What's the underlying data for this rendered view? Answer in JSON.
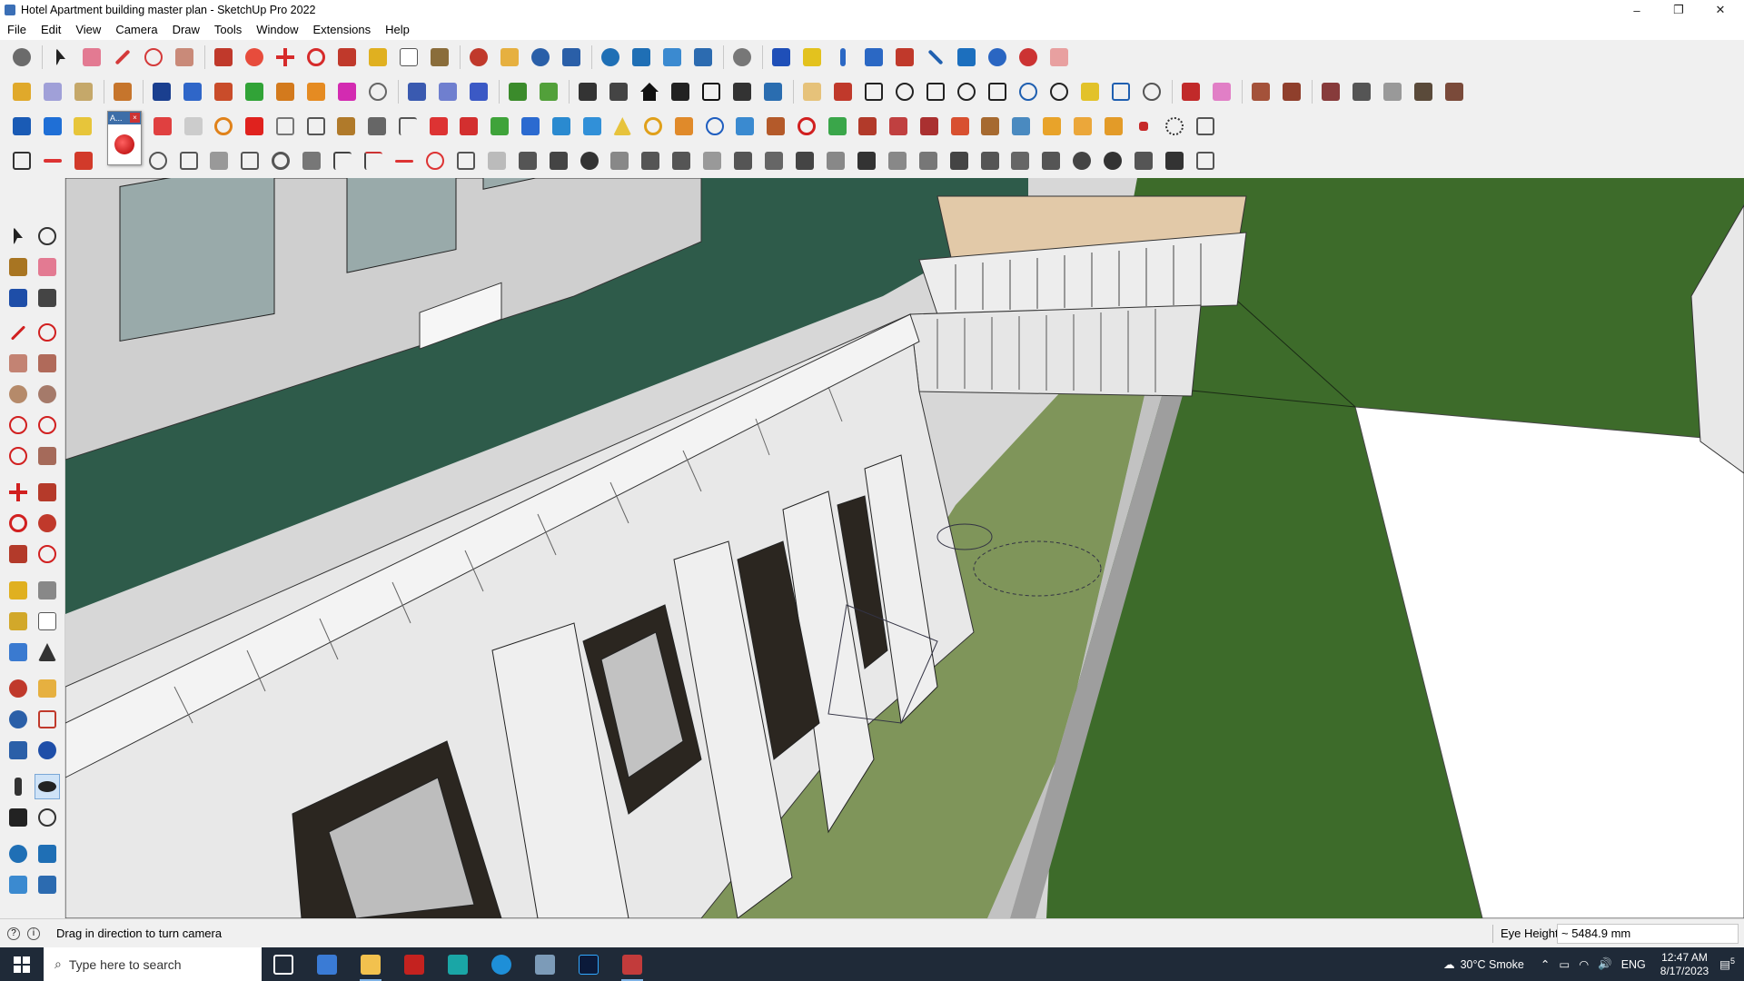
{
  "window": {
    "title": "Hotel Apartment building master plan - SketchUp Pro 2022",
    "controls": [
      "–",
      "❐",
      "✕"
    ]
  },
  "menu": [
    "File",
    "Edit",
    "View",
    "Camera",
    "Draw",
    "Tools",
    "Window",
    "Extensions",
    "Help"
  ],
  "toolbar_overlay": {
    "label": "A..."
  },
  "status": {
    "hint": "Drag in direction to turn camera",
    "measure_label": "Eye Height",
    "measure_value": "~ 5484.9 mm"
  },
  "taskbar": {
    "search_placeholder": "Type here to search",
    "weather": "30°C  Smoke",
    "language": "ENG",
    "time": "12:47 AM",
    "date": "8/17/2023",
    "notifications": "5"
  },
  "colors": {
    "accent_blue": "#3b6fb6",
    "lawn": "#7f955a",
    "grass_dark": "#3d6b2a",
    "roof_green": "#2e5b4a",
    "building": "#e8e8e8",
    "taskbar": "#1f2a38"
  }
}
